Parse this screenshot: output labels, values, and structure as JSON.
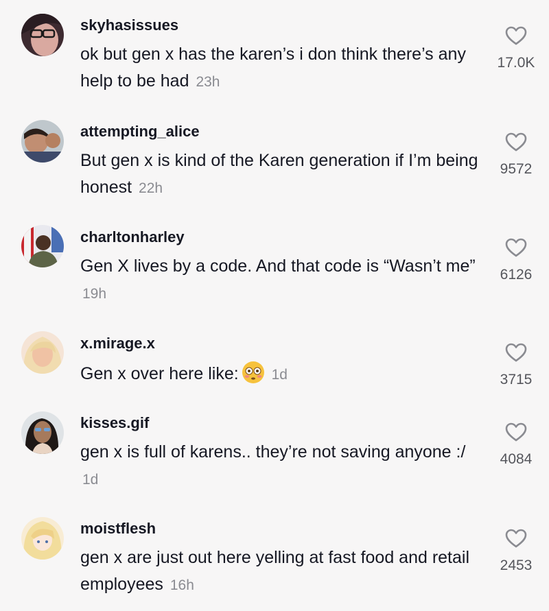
{
  "comments": [
    {
      "username": "skyhasissues",
      "text": "ok but gen x has the karen’s i don think there’s any help to be had",
      "time": "23h",
      "likes": "17.0K",
      "avatar_color": "#6b4f55"
    },
    {
      "username": "attempting_alice",
      "text": "But gen x is kind of the Karen generation if I’m being honest",
      "time": "22h",
      "likes": "9572",
      "avatar_color": "#c49a82"
    },
    {
      "username": "charltonharley",
      "text": "Gen X lives by a code. And that code is “Wasn’t me”",
      "time": "19h",
      "likes": "6126",
      "avatar_color": "#5b5f49"
    },
    {
      "username": "x.mirage.x",
      "text": "Gen x over here like:",
      "time": "1d",
      "likes": "3715",
      "avatar_color": "#e8c6a6",
      "emoji": "flushed-face-emoji"
    },
    {
      "username": "kisses.gif",
      "text": "gen x is full of karens.. they’re not saving anyone :/",
      "time": "1d",
      "likes": "4084",
      "avatar_color": "#7c6a58"
    },
    {
      "username": "moistflesh",
      "text": "gen x are just out here yelling at fast food and retail employees",
      "time": "16h",
      "likes": "2453",
      "avatar_color": "#f0dcae"
    }
  ]
}
